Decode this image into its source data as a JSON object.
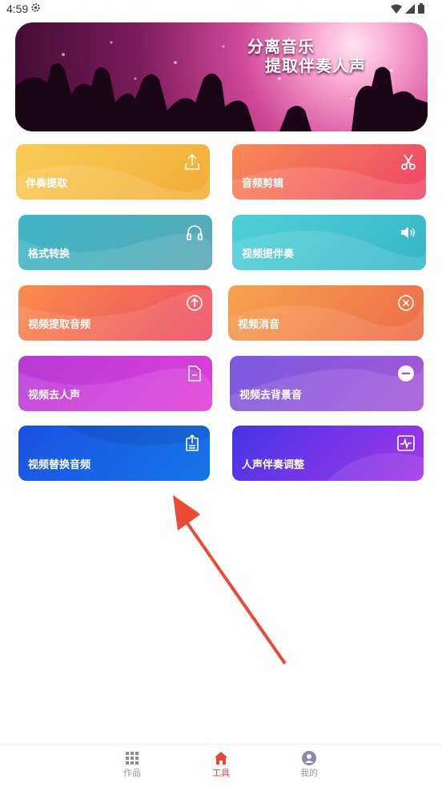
{
  "status": {
    "time": "4:59"
  },
  "banner": {
    "line1": "分离音乐",
    "line2": "提取伴奏人声"
  },
  "tools": [
    {
      "label": "伴奏提取",
      "icon": "upload-icon"
    },
    {
      "label": "音频剪辑",
      "icon": "scissors-icon"
    },
    {
      "label": "格式转换",
      "icon": "headphones-icon"
    },
    {
      "label": "视频提伴奏",
      "icon": "speaker-icon"
    },
    {
      "label": "视频提取音频",
      "icon": "arrow-up-circle-icon"
    },
    {
      "label": "视频消音",
      "icon": "close-circle-icon"
    },
    {
      "label": "视频去人声",
      "icon": "file-minus-icon"
    },
    {
      "label": "视频去背景音",
      "icon": "minus-circle-icon"
    },
    {
      "label": "视频替换音频",
      "icon": "file-upload-icon"
    },
    {
      "label": "人声伴奏调整",
      "icon": "waveform-box-icon"
    }
  ],
  "nav": [
    {
      "label": "作品",
      "icon": "grid-icon",
      "active": false
    },
    {
      "label": "工具",
      "icon": "home-icon",
      "active": true
    },
    {
      "label": "我的",
      "icon": "user-icon",
      "active": false
    }
  ],
  "colors": {
    "accent": "#e8463a",
    "inactive": "#999999"
  }
}
